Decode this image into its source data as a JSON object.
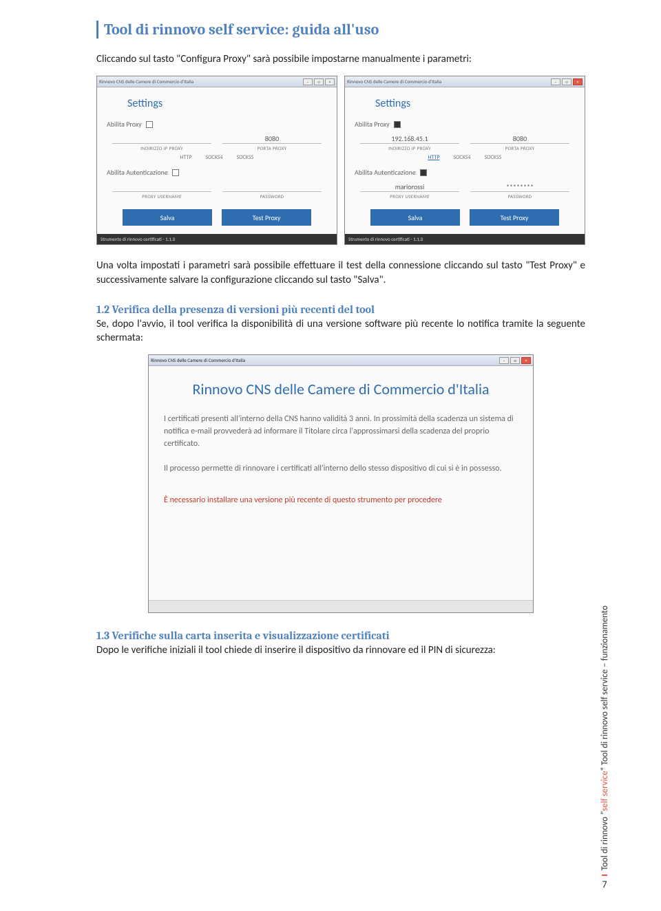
{
  "title": "Tool di rinnovo self service: guida all'uso",
  "intro_text": "Cliccando sul tasto \"Configura Proxy\" sarà possibile impostarne manualmente i parametri:",
  "settings": {
    "win_title": "Rinnovo CNS delle Camere di Commercio d'Italia",
    "heading": "Settings",
    "abilita_proxy": "Abilita Proxy",
    "ip_label": "INDIRIZZO IP PROXY",
    "port_label": "PORTA PROXY",
    "radio_http": "HTTP",
    "radio_socks4": "SOCKS4",
    "radio_socks5": "SOCKS5",
    "abilita_auth": "Abilita Autenticazione",
    "user_label": "PROXY USERNAME",
    "pass_label": "PASSWORD",
    "save_btn": "Salva",
    "test_btn": "Test Proxy",
    "status": "Strumento di rinnovo certificati - 1.1.0",
    "left": {
      "port": "8080"
    },
    "right": {
      "ip": "192.168.45.1",
      "port": "8080",
      "user": "mariorossi",
      "pass": "********"
    }
  },
  "para2": "Una volta impostati i parametri sarà possibile effettuare il test della connessione cliccando sul tasto \"Test Proxy\" e successivamente salvare la configurazione cliccando sul tasto \"Salva\".",
  "sec12_title": "1.2   Verifica della presenza di versioni più recenti del tool",
  "sec12_body": "Se, dopo l'avvio, il tool verifica la disponibilità di una versione software più recente lo notifica tramite la seguente schermata:",
  "big": {
    "win_title": "Rinnovo CNS delle Camere di Commercio d'Italia",
    "heading": "Rinnovo CNS delle Camere di Commercio d'Italia",
    "p1": "I certificati presenti all'interno della CNS hanno validità 3 anni. In prossimità della scadenza un sistema di notifica e-mail provvederà ad informare il Titolare circa l'approssimarsi della scadenza del proprio certificato.",
    "p2": "Il processo permette di rinnovare i certificati all'interno dello stesso dispositivo di cui si è in possesso.",
    "err": "È necessario installare una versione più recente di questo strumento per procedere"
  },
  "sec13_title": "1.3   Verifiche sulla carta inserita e visualizzazione certificati",
  "sec13_body": "Dopo le verifiche iniziali il tool chiede di inserire il dispositivo da rinnovare ed il PIN di sicurezza:",
  "vrail": {
    "line_prefix": "Tool di rinnovo \"",
    "line_em": "self service",
    "line_suffix": "\" Tool di rinnovo self service – funzionamento",
    "page_no": "7"
  }
}
